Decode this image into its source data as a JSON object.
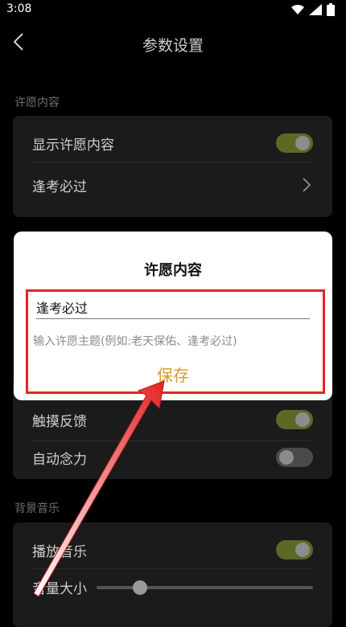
{
  "status_bar": {
    "time": "3:08"
  },
  "header": {
    "title": "参数设置"
  },
  "sections": {
    "wish": {
      "label": "许愿内容",
      "rows": [
        {
          "label": "显示许愿内容",
          "toggle": "on"
        },
        {
          "label": "逢考必过"
        }
      ]
    },
    "feedback": {
      "rows": [
        {
          "label": "触摸反馈",
          "toggle": "on"
        },
        {
          "label": "自动念力",
          "toggle": "off"
        }
      ]
    },
    "music": {
      "label": "背景音乐",
      "rows": [
        {
          "label": "播放音乐",
          "toggle": "on"
        },
        {
          "label": "音量大小"
        }
      ],
      "volume_level": 0.2
    }
  },
  "dialog": {
    "title": "许愿内容",
    "input_value": "逢考必过",
    "hint": "输入许愿主题(例如:老天保佑、逢考必过)",
    "save_label": "保存"
  },
  "colors": {
    "accent": "#d99a2a",
    "toggle_on": "#5a6a25",
    "annotation": "#e32525"
  }
}
